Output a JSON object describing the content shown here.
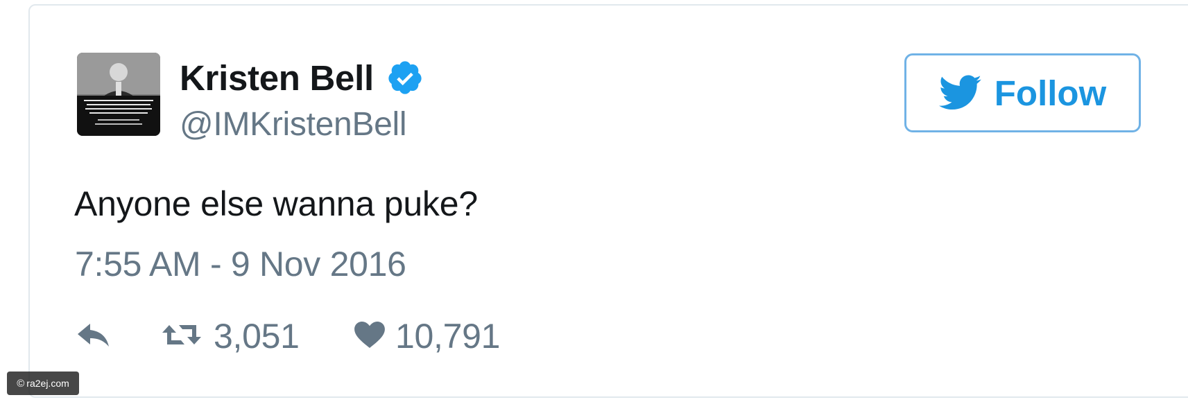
{
  "tweet": {
    "display_name": "Kristen Bell",
    "handle": "@IMKristenBell",
    "text": "Anyone else wanna puke?",
    "timestamp": "7:55 AM - 9 Nov 2016",
    "verified": true
  },
  "follow_button": {
    "label": "Follow"
  },
  "actions": {
    "retweet_count": "3,051",
    "like_count": "10,791"
  },
  "watermark": {
    "text": "ra2ej.com",
    "symbol": "©"
  },
  "colors": {
    "twitter_blue": "#1b95e0",
    "verified_blue": "#1da1f2",
    "text_primary": "#14171a",
    "text_secondary": "#657786",
    "border": "#e1e8ed"
  }
}
